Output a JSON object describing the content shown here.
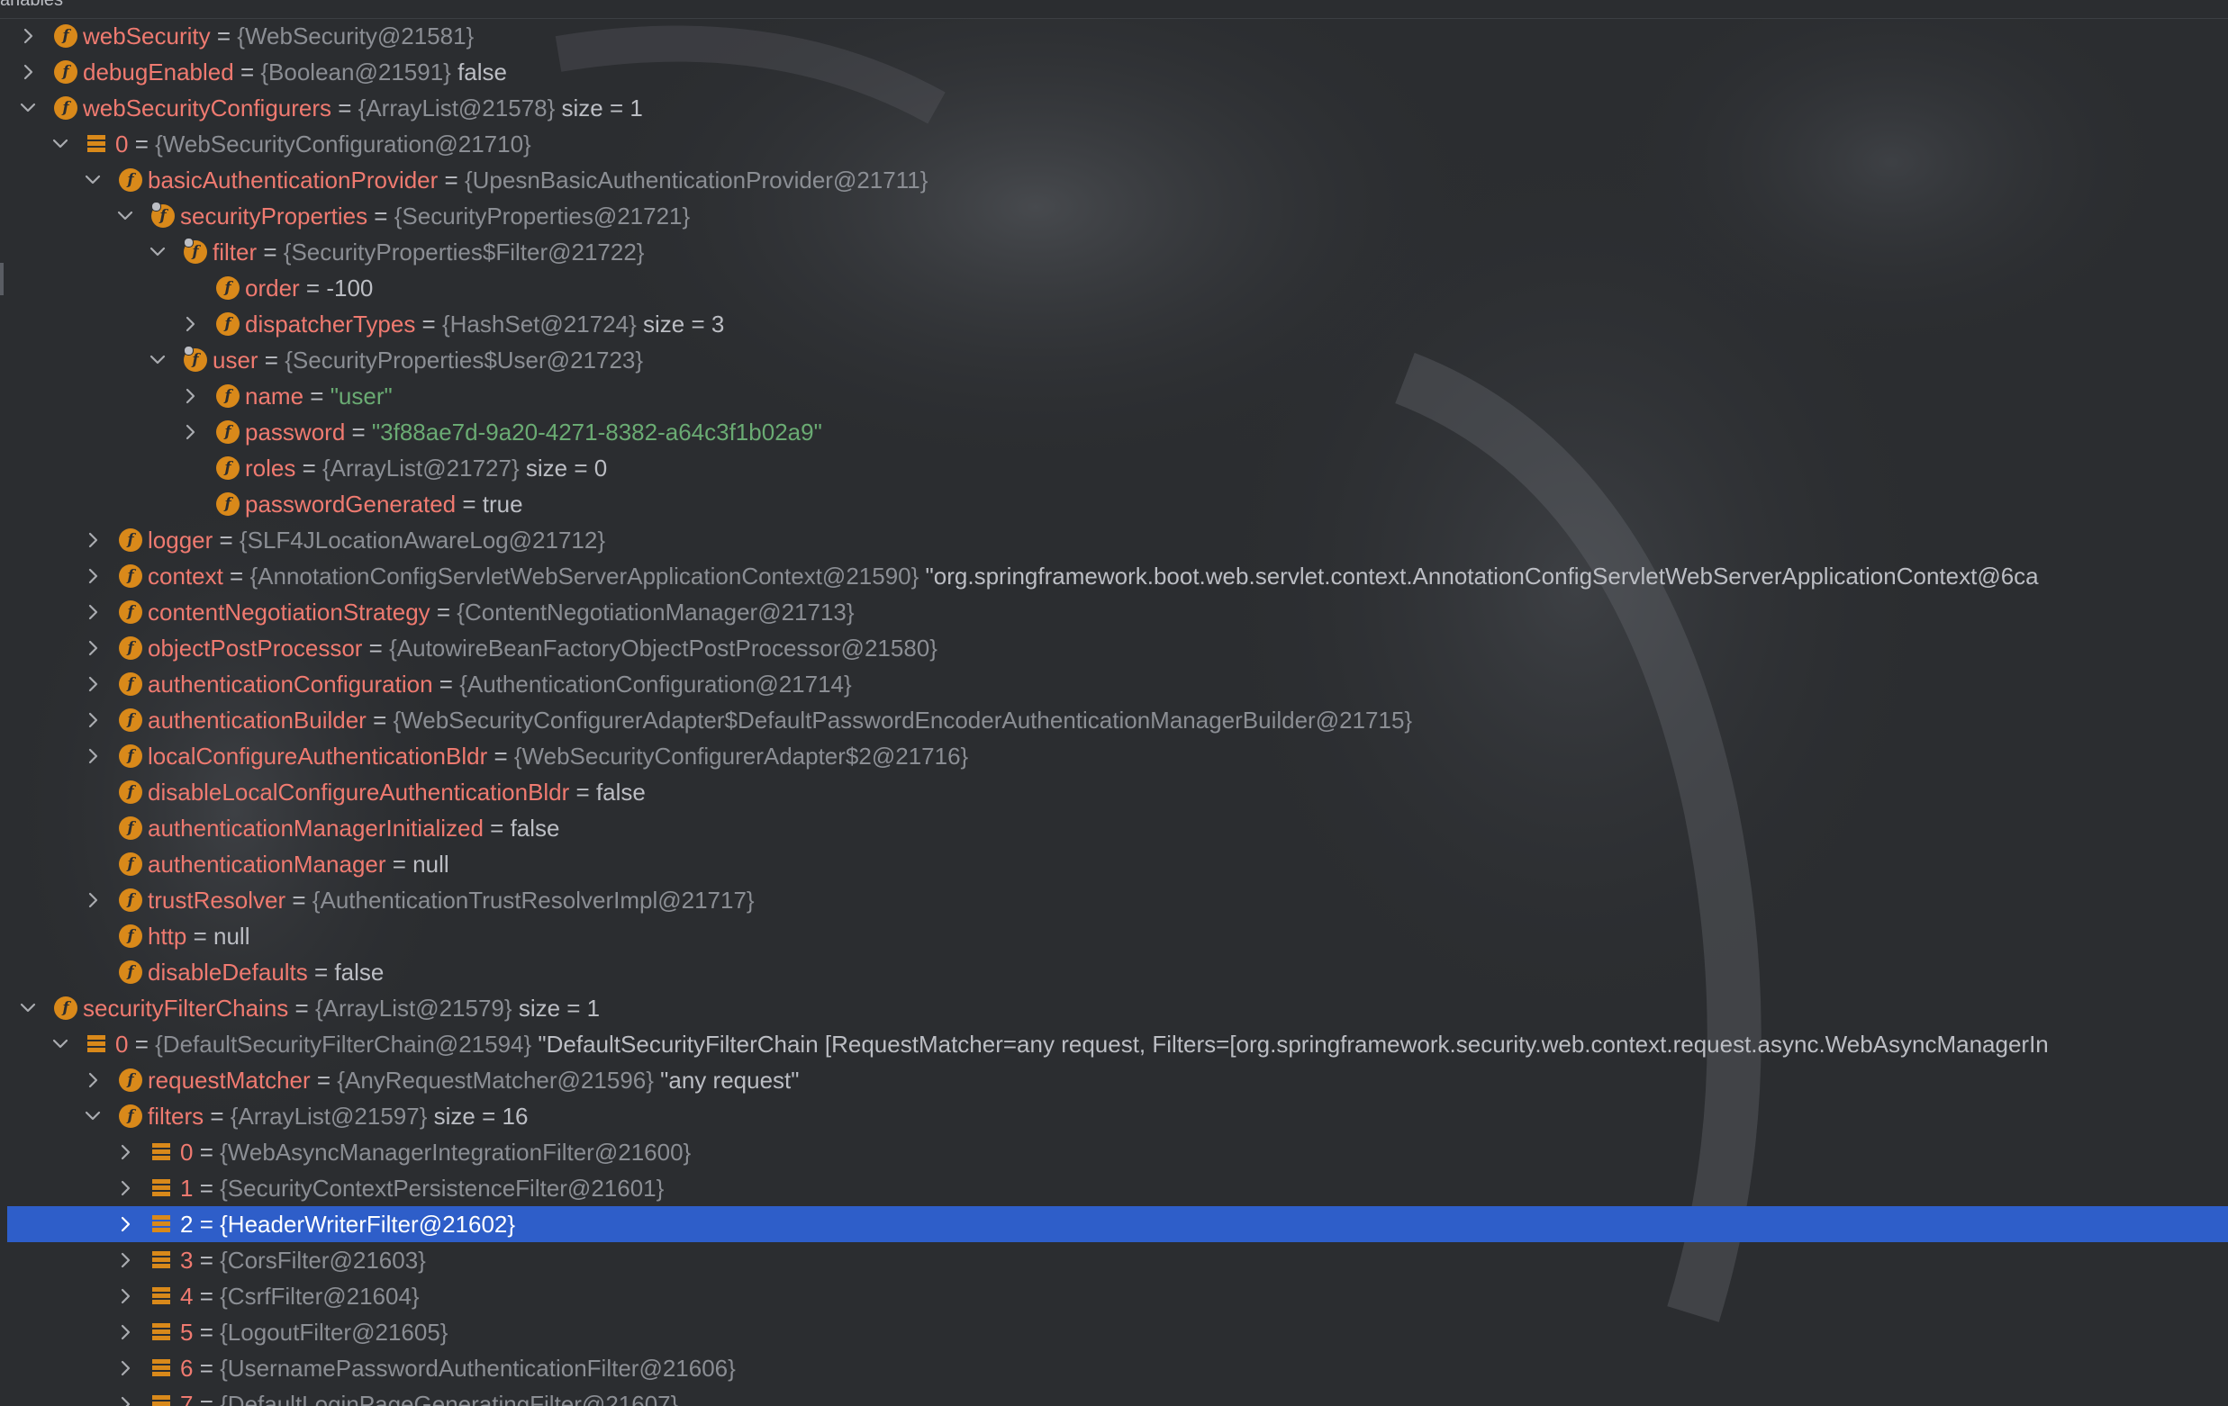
{
  "panel": {
    "title": "ariables"
  },
  "rows": [
    {
      "name": "webSecurity",
      "type": "{WebSecurity@21581}"
    },
    {
      "name": "debugEnabled",
      "type": "{Boolean@21591}",
      "value": "false"
    },
    {
      "name": "webSecurityConfigurers",
      "type": "{ArrayList@21578}",
      "value": "size = 1"
    },
    {
      "name": "0",
      "type": "{WebSecurityConfiguration@21710}"
    },
    {
      "name": "basicAuthenticationProvider",
      "type": "{UpesnBasicAuthenticationProvider@21711}"
    },
    {
      "name": "securityProperties",
      "type": "{SecurityProperties@21721}"
    },
    {
      "name": "filter",
      "type": "{SecurityProperties$Filter@21722}"
    },
    {
      "name": "order",
      "value": "-100"
    },
    {
      "name": "dispatcherTypes",
      "type": "{HashSet@21724}",
      "value": "size = 3"
    },
    {
      "name": "user",
      "type": "{SecurityProperties$User@21723}"
    },
    {
      "name": "name",
      "value": "\"user\""
    },
    {
      "name": "password",
      "value": "\"3f88ae7d-9a20-4271-8382-a64c3f1b02a9\""
    },
    {
      "name": "roles",
      "type": "{ArrayList@21727}",
      "value": "size = 0"
    },
    {
      "name": "passwordGenerated",
      "value": "true"
    },
    {
      "name": "logger",
      "type": "{SLF4JLocationAwareLog@21712}"
    },
    {
      "name": "context",
      "type": "{AnnotationConfigServletWebServerApplicationContext@21590}",
      "value": "\"org.springframework.boot.web.servlet.context.AnnotationConfigServletWebServerApplicationContext@6ca"
    },
    {
      "name": "contentNegotiationStrategy",
      "type": "{ContentNegotiationManager@21713}"
    },
    {
      "name": "objectPostProcessor",
      "type": "{AutowireBeanFactoryObjectPostProcessor@21580}"
    },
    {
      "name": "authenticationConfiguration",
      "type": "{AuthenticationConfiguration@21714}"
    },
    {
      "name": "authenticationBuilder",
      "type": "{WebSecurityConfigurerAdapter$DefaultPasswordEncoderAuthenticationManagerBuilder@21715}"
    },
    {
      "name": "localConfigureAuthenticationBldr",
      "type": "{WebSecurityConfigurerAdapter$2@21716}"
    },
    {
      "name": "disableLocalConfigureAuthenticationBldr",
      "value": "false"
    },
    {
      "name": "authenticationManagerInitialized",
      "value": "false"
    },
    {
      "name": "authenticationManager",
      "value": "null"
    },
    {
      "name": "trustResolver",
      "type": "{AuthenticationTrustResolverImpl@21717}"
    },
    {
      "name": "http",
      "value": "null"
    },
    {
      "name": "disableDefaults",
      "value": "false"
    },
    {
      "name": "securityFilterChains",
      "type": "{ArrayList@21579}",
      "value": "size = 1"
    },
    {
      "name": "0",
      "type": "{DefaultSecurityFilterChain@21594}",
      "value": "\"DefaultSecurityFilterChain [RequestMatcher=any request, Filters=[org.springframework.security.web.context.request.async.WebAsyncManagerIn"
    },
    {
      "name": "requestMatcher",
      "type": "{AnyRequestMatcher@21596}",
      "value": "\"any request\""
    },
    {
      "name": "filters",
      "type": "{ArrayList@21597}",
      "value": "size = 16"
    },
    {
      "name": "0",
      "type": "{WebAsyncManagerIntegrationFilter@21600}"
    },
    {
      "name": "1",
      "type": "{SecurityContextPersistenceFilter@21601}"
    },
    {
      "name": "2",
      "type": "{HeaderWriterFilter@21602}"
    },
    {
      "name": "3",
      "type": "{CorsFilter@21603}"
    },
    {
      "name": "4",
      "type": "{CsrfFilter@21604}"
    },
    {
      "name": "5",
      "type": "{LogoutFilter@21605}"
    },
    {
      "name": "6",
      "type": "{UsernamePasswordAuthenticationFilter@21606}"
    },
    {
      "name": "7",
      "type": "{DefaultLoginPageGeneratingFilter@21607}"
    }
  ],
  "selected_row": "2 = {HeaderWriterFilter@21602}",
  "colors": {
    "background": "#2b2d30",
    "field_name": "#ef7a70",
    "type_text": "#8b8e94",
    "string_value": "#6aab73",
    "selection": "#2e5ec9",
    "field_icon": "#d9891a"
  },
  "icons": {
    "field": "field-icon",
    "array_element": "array-element-icon",
    "expand": "chevron-right-icon",
    "collapse": "chevron-down-icon"
  }
}
